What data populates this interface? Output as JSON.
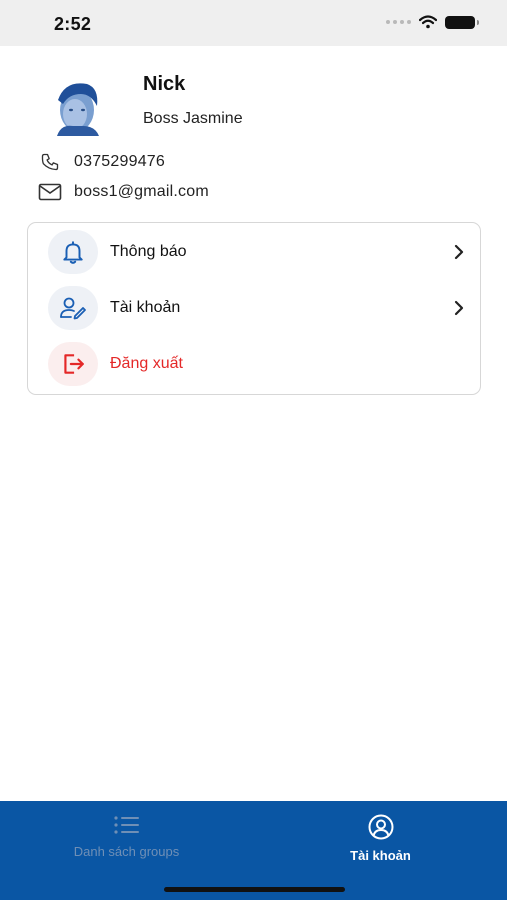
{
  "status_bar": {
    "time": "2:52"
  },
  "profile": {
    "name": "Nick",
    "role": "Boss Jasmine",
    "phone": "0375299476",
    "email": "boss1@gmail.com"
  },
  "menu": {
    "items": [
      {
        "label": "Thông báo",
        "icon": "bell-icon"
      },
      {
        "label": "Tài khoản",
        "icon": "user-edit-icon"
      },
      {
        "label": "Đăng xuất",
        "icon": "logout-icon"
      }
    ]
  },
  "tabs": [
    {
      "label": "Danh sách groups",
      "icon": "list-icon",
      "active": false
    },
    {
      "label": "Tài khoản",
      "icon": "user-circle-icon",
      "active": true
    }
  ],
  "colors": {
    "primary": "#0a56a4",
    "danger": "#e42828",
    "icon_blue": "#1a5fb4"
  }
}
